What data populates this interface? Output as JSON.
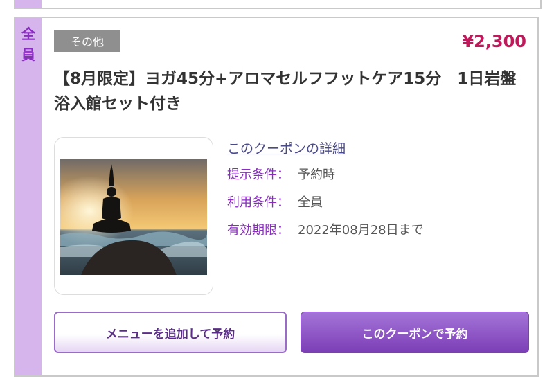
{
  "coupon": {
    "target_label": "全\n員",
    "category_tag": "その他",
    "price": "¥2,300",
    "title": "【8月限定】ヨガ45分+アロマセルフフットケア15分　1日岩盤浴入館セット付き",
    "image_icon": "yoga-silhouette-sunset-image",
    "detail_link": "このクーポンの詳細",
    "conditions": [
      {
        "label": "提示条件：",
        "value": "予約時"
      },
      {
        "label": "利用条件：",
        "value": "全員"
      },
      {
        "label": "有効期限：",
        "value": "2022年08月28日まで"
      }
    ],
    "buttons": {
      "add_menu": "メニューを追加して予約",
      "book_coupon": "このクーポンで予約"
    }
  },
  "colors": {
    "accent_purple": "#8a2cc2",
    "strip_purple": "#d6b4ec",
    "price_red": "#c2185b",
    "tag_gray": "#8f8f8f"
  }
}
